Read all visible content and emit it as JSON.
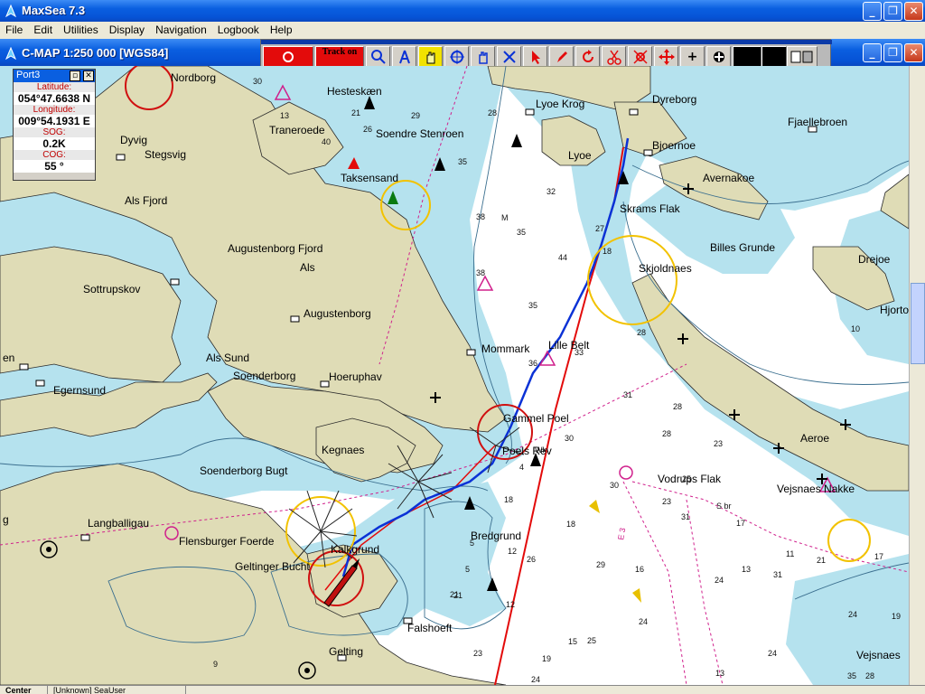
{
  "window": {
    "title": "MaxSea 7.3"
  },
  "menu": [
    "File",
    "Edit",
    "Utilities",
    "Display",
    "Navigation",
    "Logbook",
    "Help"
  ],
  "chart_window": {
    "title": "C-MAP  1:250 000 [WGS84]"
  },
  "toolbar": {
    "track_label": "Track on"
  },
  "port": {
    "title": "Port3",
    "fields": [
      {
        "label": "Latitude:",
        "value": "054°47.6638 N"
      },
      {
        "label": "Longitude:",
        "value": "009°54.1931 E"
      },
      {
        "label": "SOG:",
        "value": "0.2K"
      },
      {
        "label": "COG:",
        "value": "55 °"
      }
    ]
  },
  "places": {
    "nordborg": "Nordborg",
    "hestesk": "Hesteskæn",
    "traneroed": "Traneroede",
    "soendre": "Soendre Stenroen",
    "dyvig": "Dyvig",
    "stegsvig": "Stegsvig",
    "taksensand": "Taksensand",
    "alsfjord": "Als Fjord",
    "augfjord": "Augustenborg Fjord",
    "als": "Als",
    "sottrup": "Sottrupskov",
    "augustenborg": "Augustenborg",
    "alssund": "Als Sund",
    "soenderborg": "Soenderborg",
    "hoeruphav": "Hoeruphav",
    "egernsund": "Egernsund",
    "en": "en",
    "mommark": "Mommark",
    "lyoekrog": "Lyoe Krog",
    "lyoe": "Lyoe",
    "dyreborg": "Dyreborg",
    "fjaellebroen": "Fjaellebroen",
    "bjoernoe": "Bjoernoe",
    "avernakoe": "Avernakoe",
    "skramsflak": "Skrams Flak",
    "billes": "Billes Grunde",
    "drejoe": "Drejoe",
    "skjoldnaes": "Skjoldnaes",
    "hjortoe": "Hjorto",
    "lilleblt": "Lille Belt",
    "gammelpoel": "Gammel Poel",
    "poelsrev": "Poels Rev",
    "kegnaes": "Kegnaes",
    "soenderbugt": "Soenderborg Bugt",
    "vodrups": "Vodrups Flak",
    "aeroe": "Aeroe",
    "vejsnakke": "Vejsnaes Nakke",
    "langballigau": "Langballigau",
    "flensburg": "Flensburger Foerde",
    "kalkgrund": "Kalkgrund",
    "geltingerbucht": "Geltinger Bucht",
    "bredgrund": "Bredgrund",
    "falshoeft": "Falshoeft",
    "gelting": "Gelting",
    "vejsnaes": "Vejsnaes",
    "g": "g"
  },
  "depths": [
    "30",
    "29",
    "28",
    "26",
    "40",
    "13",
    "21",
    "35",
    "32",
    "38",
    "35",
    "27",
    "18",
    "44",
    "38",
    "35",
    "36",
    "33",
    "31",
    "28",
    "30",
    "4",
    "18",
    "31",
    "23",
    "13",
    "17",
    "24",
    "21",
    "19",
    "12",
    "26",
    "16",
    "24",
    "24",
    "24",
    "23",
    "15",
    "21",
    "12",
    "24",
    "30",
    "11",
    "9",
    "13",
    "5",
    "10",
    "28",
    "25",
    "17",
    "31",
    "28",
    "35",
    "19",
    "18",
    "21",
    "5",
    "Wk",
    "23",
    "25",
    "29",
    "28"
  ],
  "depth_labels": {
    "m": "M",
    "sbr": "S br",
    "e": "E 3"
  },
  "colors": {
    "land": "#dfdcb6",
    "shallow": "#b5e2ee",
    "deep": "#ffffff",
    "route_red": "#e30b0b",
    "route_blue": "#0b32d6"
  },
  "status": {
    "left": "Center Off",
    "user": "[Unknown] SeaUser"
  }
}
